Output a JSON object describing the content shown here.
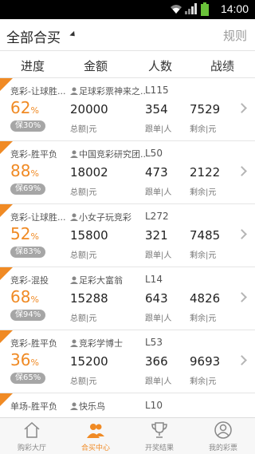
{
  "status_bar": {
    "time": "14:00"
  },
  "header": {
    "title": "全部合买",
    "rules_label": "规则"
  },
  "columns": [
    "进度",
    "金额",
    "人数",
    "战绩"
  ],
  "unit_labels": {
    "total": "总额",
    "yuan1": "元",
    "people": "跟单",
    "ren": "人",
    "remain": "剩余",
    "yuan2": "元"
  },
  "rows": [
    {
      "name": "竞彩-让球胜...",
      "pct": "62",
      "bao": "保30%",
      "user": "足球彩票神来之...",
      "level": "L115",
      "amount": "20000",
      "count": "354",
      "remain": "7529"
    },
    {
      "name": "竞彩-胜平负",
      "pct": "88",
      "bao": "保69%",
      "user": "中国竞彩研究团...",
      "level": "L50",
      "amount": "18002",
      "count": "473",
      "remain": "2122"
    },
    {
      "name": "竞彩-让球胜...",
      "pct": "52",
      "bao": "保83%",
      "user": "小女子玩竞彩",
      "level": "L272",
      "amount": "15800",
      "count": "321",
      "remain": "7485"
    },
    {
      "name": "竞彩-混投",
      "pct": "68",
      "bao": "保94%",
      "user": "足彩大富翁",
      "level": "L14",
      "amount": "15288",
      "count": "643",
      "remain": "4826"
    },
    {
      "name": "竞彩-胜平负",
      "pct": "36",
      "bao": "保65%",
      "user": "竞彩学博士",
      "level": "L53",
      "amount": "15200",
      "count": "366",
      "remain": "9693"
    },
    {
      "name": "单场-胜平负",
      "pct": "",
      "bao": "",
      "user": "快乐鸟",
      "level": "L10",
      "amount": "",
      "count": "",
      "remain": ""
    }
  ],
  "pct_suffix": "%",
  "tabs": [
    {
      "label": "购彩大厅",
      "icon": "home-icon"
    },
    {
      "label": "合买中心",
      "icon": "users-icon",
      "active": true
    },
    {
      "label": "开奖结果",
      "icon": "trophy-icon"
    },
    {
      "label": "我的彩票",
      "icon": "user-icon"
    }
  ],
  "colors": {
    "accent": "#f08a24",
    "badge": "#a6a6a6"
  }
}
